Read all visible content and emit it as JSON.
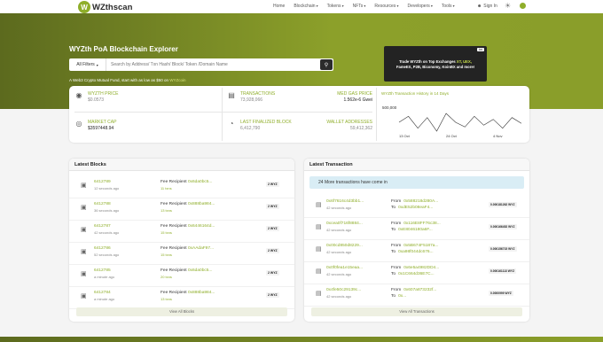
{
  "brand": {
    "name": "WZthscan",
    "accent": "#8fae2a"
  },
  "nav": {
    "items": [
      {
        "label": "Home",
        "dropdown": false
      },
      {
        "label": "Blockchain",
        "dropdown": true
      },
      {
        "label": "Tokens",
        "dropdown": true
      },
      {
        "label": "NFTs",
        "dropdown": true
      },
      {
        "label": "Resources",
        "dropdown": true
      },
      {
        "label": "Developers",
        "dropdown": true
      },
      {
        "label": "Tools",
        "dropdown": true
      }
    ],
    "sign_in": "Sign In"
  },
  "hero": {
    "title": "WYZth PoA Blockchain Explorer",
    "filter": "All Filters",
    "search_placeholder": "Search by Address/ Txn Hash/ Block/ Token /Domain Name",
    "promo_text": "A Web3 Crypto Mutual Fund, start with as low as $50 on",
    "promo_link": "WYZcoin",
    "ad": {
      "badge": "Ad",
      "line1_prefix": "Trade WYZth on Top Exchanges",
      "line1_highlight": "XT, UEX,",
      "line2": "FameEX, P2B, Biconomy, KoinBX and more!"
    }
  },
  "stats": {
    "price_label": "WYZTH PRICE",
    "price_value": "$0.0573",
    "market_cap_label": "MARKET CAP",
    "market_cap_value": "$3597448.94",
    "transactions_label": "TRANSACTIONS",
    "transactions_value": "73,928,066",
    "gas_label": "MED GAS PRICE",
    "gas_value": "1.562e-6 Gwei",
    "finalized_label": "LAST FINALIZED BLOCK",
    "finalized_value": "6,412,790",
    "wallets_label": "WALLET ADDRESSES",
    "wallets_value": "59,412,362"
  },
  "chart_data": {
    "type": "line",
    "title": "WYZth Transaction History in 14 Days",
    "ytick": "500,000",
    "xticks": [
      "13 Oct",
      "24 Oct",
      "4 Nov"
    ],
    "values": [
      470,
      480,
      460,
      478,
      455,
      485,
      470,
      462,
      480,
      465,
      475,
      460,
      478,
      468
    ]
  },
  "latest_blocks": {
    "title": "Latest Blocks",
    "fee_prefix": "Fee Recipient",
    "view_all": "View All Blocks",
    "rows": [
      {
        "number": "6412789",
        "time": "12 seconds ago",
        "recipient": "0x6da0bc5...",
        "txns": "11 txns",
        "reward": "2 WYZ"
      },
      {
        "number": "6412788",
        "time": "36 seconds ago",
        "recipient": "0x888ba984...",
        "txns": "13 txns",
        "reward": "2 WYZ"
      },
      {
        "number": "6412787",
        "time": "42 seconds ago",
        "recipient": "0x6446164d...",
        "txns": "15 txns",
        "reward": "2 WYZ"
      },
      {
        "number": "6412786",
        "time": "52 seconds ago",
        "recipient": "0xAAdaF97...",
        "txns": "15 txns",
        "reward": "2 WYZ"
      },
      {
        "number": "6412785",
        "time": "a minute ago",
        "recipient": "0x6da0bc5...",
        "txns": "20 txns",
        "reward": "2 WYZ"
      },
      {
        "number": "6412784",
        "time": "a minute ago",
        "recipient": "0x888ba984...",
        "txns": "13 txns",
        "reward": "2 WYZ"
      }
    ]
  },
  "latest_transactions": {
    "title": "Latest Transaction",
    "banner": "24 More transactions have come in",
    "from_label": "From",
    "to_label": "To",
    "view_all": "View All Transactions",
    "rows": [
      {
        "hash": "0x6f7616c4d3bb1...",
        "time": "42 seconds ago",
        "from": "0x588218d280A...",
        "to": "0xdE52b08eaF4...",
        "value": "0.000181262 WYZ"
      },
      {
        "hash": "0xcea0f716f8884...",
        "time": "42 seconds ago",
        "from": "0x116E8FF76c38...",
        "to": "0xE8046180a6F...",
        "value": "0.000166452 WYZ"
      },
      {
        "hash": "0x00cd850d8229...",
        "time": "42 seconds ago",
        "from": "0x5B674F5187a...",
        "to": "0xa98f044dc676...",
        "value": "0.000156715 WYZ"
      },
      {
        "hash": "0x0f0fea1e15eaa...",
        "time": "42 seconds ago",
        "from": "0x6e5a4982DD4...",
        "to": "0x1C664d36E7C...",
        "value": "0.000161113 WYZ"
      },
      {
        "hash": "0x4fe50c29139c...",
        "time": "42 seconds ago",
        "from": "0x607a873232f...",
        "to": "0x...",
        "value": "0.0000999 WYZ"
      }
    ]
  }
}
